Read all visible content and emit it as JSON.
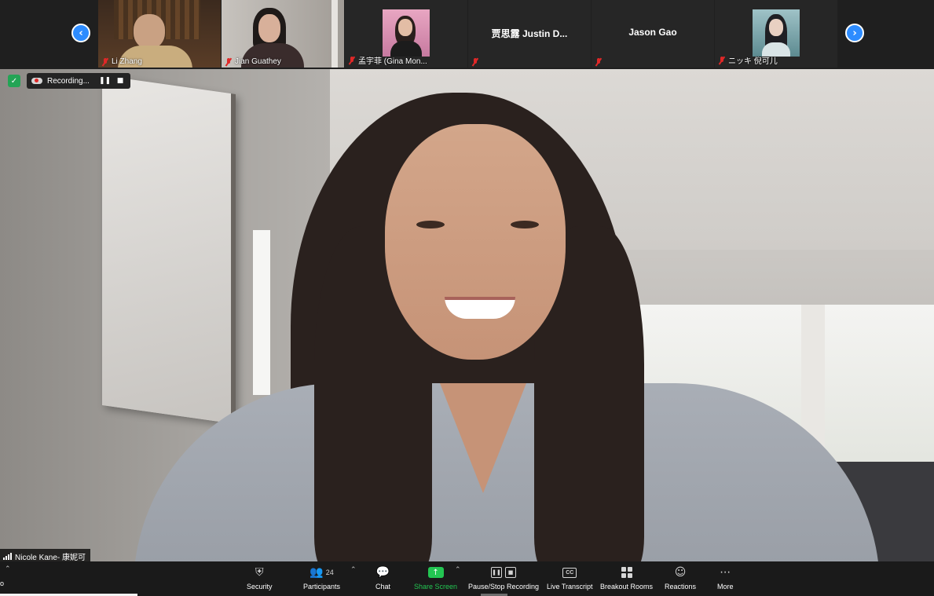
{
  "gallery": {
    "tiles": [
      {
        "name": "Li Zhang"
      },
      {
        "name": "Jian Guathey"
      },
      {
        "name": "孟宇菲 (Gina Mon..."
      },
      {
        "name": "贾思露  Justin D..."
      },
      {
        "name": "Jason Gao"
      },
      {
        "name": "ニッキ 倪可儿"
      }
    ]
  },
  "recording": {
    "status": "Recording..."
  },
  "speaker": {
    "name": "Nicole Kane- 康妮可"
  },
  "toolbar": {
    "security": "Security",
    "participants": "Participants",
    "participants_count": "24",
    "chat": "Chat",
    "share_screen": "Share Screen",
    "recording": "Pause/Stop Recording",
    "transcript": "Live Transcript",
    "breakout": "Breakout Rooms",
    "reactions": "Reactions",
    "more": "More",
    "cc_icon_text": "CC"
  },
  "edge": {
    "left_text": "o"
  },
  "colors": {
    "accent": "#2d8cff",
    "share_green": "#23c552",
    "mute_red": "#e02828",
    "secure_green": "#23a455"
  }
}
